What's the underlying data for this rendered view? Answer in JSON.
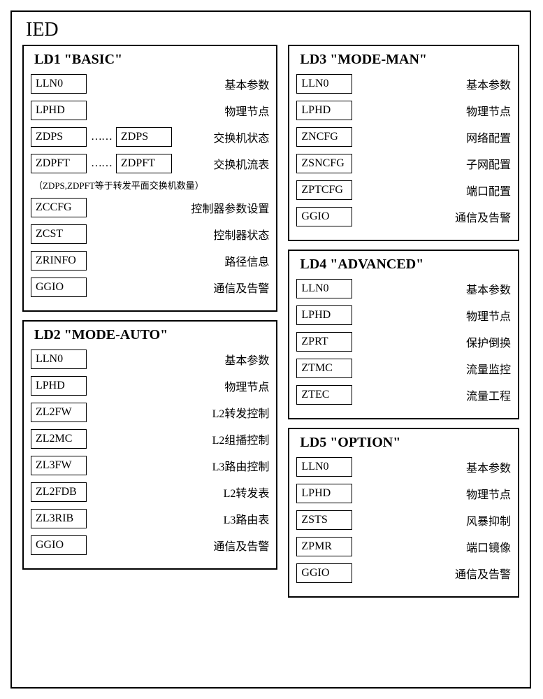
{
  "ied_title": "IED",
  "ld1": {
    "title": "LD1  \"BASIC\"",
    "rows": [
      {
        "nodes": [
          "LLN0"
        ],
        "label": "基本参数"
      },
      {
        "nodes": [
          "LPHD"
        ],
        "label": "物理节点"
      },
      {
        "nodes": [
          "ZDPS",
          "ZDPS"
        ],
        "ellipsis": true,
        "label": "交换机状态"
      },
      {
        "nodes": [
          "ZDPFT",
          "ZDPFT"
        ],
        "ellipsis": true,
        "label": "交换机流表"
      }
    ],
    "note": "（ZDPS,ZDPFT等于转发平面交换机数量）",
    "rows2": [
      {
        "nodes": [
          "ZCCFG"
        ],
        "label": "控制器参数设置"
      },
      {
        "nodes": [
          "ZCST"
        ],
        "label": "控制器状态"
      },
      {
        "nodes": [
          "ZRINFO"
        ],
        "label": "路径信息"
      },
      {
        "nodes": [
          "GGIO"
        ],
        "label": "通信及告警"
      }
    ]
  },
  "ld2": {
    "title": "LD2  \"MODE-AUTO\"",
    "rows": [
      {
        "nodes": [
          "LLN0"
        ],
        "label": "基本参数"
      },
      {
        "nodes": [
          "LPHD"
        ],
        "label": "物理节点"
      },
      {
        "nodes": [
          "ZL2FW"
        ],
        "label": "L2转发控制"
      },
      {
        "nodes": [
          "ZL2MC"
        ],
        "label": "L2组播控制"
      },
      {
        "nodes": [
          "ZL3FW"
        ],
        "label": "L3路由控制"
      },
      {
        "nodes": [
          "ZL2FDB"
        ],
        "label": "L2转发表"
      },
      {
        "nodes": [
          "ZL3RIB"
        ],
        "label": "L3路由表"
      },
      {
        "nodes": [
          "GGIO"
        ],
        "label": "通信及告警"
      }
    ]
  },
  "ld3": {
    "title": "LD3  \"MODE-MAN\"",
    "rows": [
      {
        "nodes": [
          "LLN0"
        ],
        "label": "基本参数"
      },
      {
        "nodes": [
          "LPHD"
        ],
        "label": "物理节点"
      },
      {
        "nodes": [
          "ZNCFG"
        ],
        "label": "网络配置"
      },
      {
        "nodes": [
          "ZSNCFG"
        ],
        "label": "子网配置"
      },
      {
        "nodes": [
          "ZPTCFG"
        ],
        "label": "端口配置"
      },
      {
        "nodes": [
          "GGIO"
        ],
        "label": "通信及告警"
      }
    ]
  },
  "ld4": {
    "title": "LD4  \"ADVANCED\"",
    "rows": [
      {
        "nodes": [
          "LLN0"
        ],
        "label": "基本参数"
      },
      {
        "nodes": [
          "LPHD"
        ],
        "label": "物理节点"
      },
      {
        "nodes": [
          "ZPRT"
        ],
        "label": "保护倒换"
      },
      {
        "nodes": [
          "ZTMC"
        ],
        "label": "流量监控"
      },
      {
        "nodes": [
          "ZTEC"
        ],
        "label": "流量工程"
      }
    ]
  },
  "ld5": {
    "title": "LD5  \"OPTION\"",
    "rows": [
      {
        "nodes": [
          "LLN0"
        ],
        "label": "基本参数"
      },
      {
        "nodes": [
          "LPHD"
        ],
        "label": "物理节点"
      },
      {
        "nodes": [
          "ZSTS"
        ],
        "label": "风暴抑制"
      },
      {
        "nodes": [
          "ZPMR"
        ],
        "label": "端口镜像"
      },
      {
        "nodes": [
          "GGIO"
        ],
        "label": "通信及告警"
      }
    ]
  }
}
